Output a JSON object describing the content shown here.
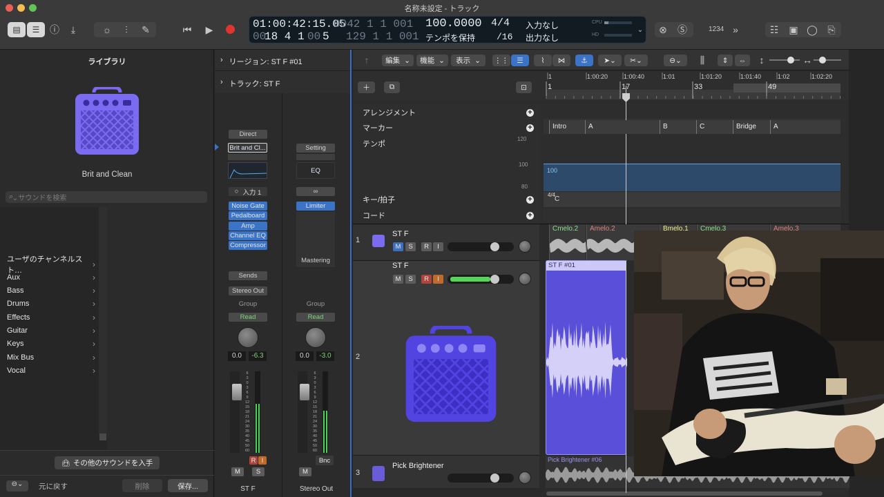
{
  "window": {
    "title": "名称未設定 - トラック"
  },
  "transport": {
    "lcd_time": "01:00:42:15.05",
    "lcd_time_shadow": "0042 1 1 001",
    "lcd_bar_shadow": "00",
    "lcd_bars": "18 4 1",
    "lcd_bars_shadow": "00",
    "lcd_ticks": "5",
    "lcd_ticks_shadow": "129 1 1 001",
    "tempo": "100.0000",
    "tempo_mode": "テンポを保持",
    "signature": "4/4",
    "division": "/16",
    "input": "入力なし",
    "output": "出力なし",
    "cpu_label": "CPU",
    "hd_label": "HD",
    "count_label": "1234"
  },
  "library": {
    "title": "ライブラリ",
    "preset_name": "Brit and Clean",
    "search_placeholder": "サウンドを検索",
    "categories": [
      {
        "label": "ユーザのチャンネルスト…"
      },
      {
        "label": "Aux"
      },
      {
        "label": "Bass"
      },
      {
        "label": "Drums"
      },
      {
        "label": "Effects"
      },
      {
        "label": "Guitar"
      },
      {
        "label": "Keys"
      },
      {
        "label": "Mix Bus"
      },
      {
        "label": "Vocal"
      }
    ],
    "get_more": "その他のサウンドを入手",
    "revert": "元に戻す",
    "delete": "削除",
    "save": "保存..."
  },
  "inspector": {
    "region_label": "リージョン: ST F #01",
    "track_label": "トラック:  ST F",
    "strip1": {
      "mode": "Direct",
      "setting": "Brit and Cl...",
      "input": "入力 1",
      "plugins": [
        "Noise Gate",
        "Pedalboard",
        "Amp",
        "Channel EQ",
        "Compressor"
      ],
      "sends": "Sends",
      "output": "Stereo Out",
      "group": "Group",
      "automation": "Read",
      "pan_value": "0.0",
      "level_value": "-6.3",
      "name": "ST F",
      "r_btn": "R",
      "i_btn": "I",
      "m_btn": "M",
      "s_btn": "S"
    },
    "strip2": {
      "setting": "Setting",
      "eq": "EQ",
      "plugins": [
        "Limiter"
      ],
      "mastering": "Mastering",
      "group": "Group",
      "automation": "Read",
      "pan_value": "0.0",
      "level_value": "-3.0",
      "bounce": "Bnc",
      "m_btn": "M",
      "name": "Stereo Out"
    },
    "fader_scale": [
      "6",
      "3",
      "0",
      "3",
      "6",
      "9",
      "12",
      "15",
      "18",
      "21",
      "24",
      "30",
      "35",
      "40",
      "45",
      "50",
      "60"
    ]
  },
  "tracks_area": {
    "menus": {
      "edit": "編集",
      "function": "機能",
      "view": "表示"
    },
    "ruler_times": [
      "1",
      "1:00:20",
      "1:00:40",
      "1:01",
      "1:01:20",
      "1:01:40",
      "1:02",
      "1:02:20"
    ],
    "ruler_bars": [
      "1",
      "17",
      "33",
      "49"
    ],
    "global_tracks": [
      {
        "label": "アレンジメント"
      },
      {
        "label": "マーカー"
      },
      {
        "label": "テンポ"
      },
      {
        "label": "キー/拍子"
      },
      {
        "label": "コード"
      }
    ],
    "tempo_scale": [
      "120",
      "100",
      "80"
    ],
    "tempo_value": "100",
    "key_sig": "4/4",
    "key_label": "C",
    "markers": [
      "Intro",
      "A",
      "B",
      "C",
      "Bridge",
      "A"
    ],
    "tracks": [
      {
        "number": "1",
        "name": "ST F"
      },
      {
        "number": "2",
        "name": "ST F"
      },
      {
        "number": "3",
        "name": "Pick Brightener"
      }
    ],
    "track1_regions": [
      "Cmelo.2",
      "Amelo.2",
      "Bmelo.1",
      "Cmelo.3",
      "Amelo.3"
    ],
    "track2_region": "ST F #01",
    "track3_region": "Pick Brightener #06",
    "mute": "M",
    "solo": "S",
    "rec": "R",
    "input": "I"
  },
  "colors": {
    "accent_blue": "#3b73c7",
    "amp_purple": "#7b6bf0",
    "region_purple": "#5a4fd8",
    "region_green": "#8ce08c",
    "region_red": "#e08080"
  }
}
